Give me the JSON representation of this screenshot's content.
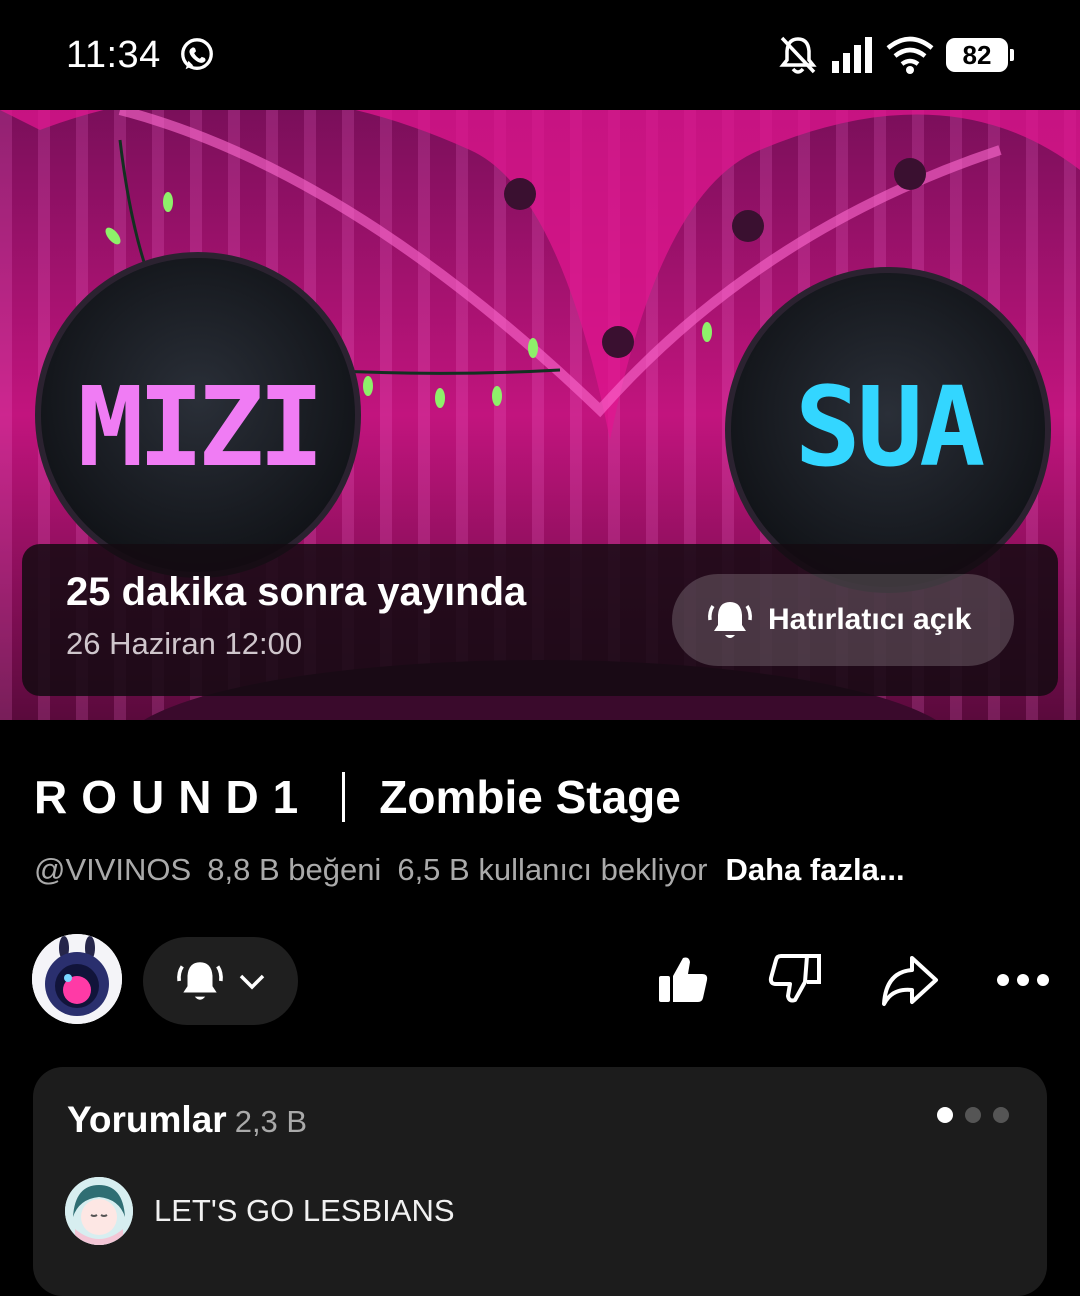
{
  "status_bar": {
    "time": "11:34",
    "battery": "82",
    "icons": [
      "whatsapp-icon",
      "bell-muted-icon",
      "signal-icon",
      "wifi-icon",
      "battery-icon"
    ]
  },
  "video": {
    "left_sign": "MIZI",
    "right_sign": "SUA",
    "live_title": "25 dakika sonra yayında",
    "live_date": "26 Haziran 12:00",
    "reminder_label": "Hatırlatıcı açık"
  },
  "title": {
    "part_a": "ROUND1",
    "part_b": "Zombie Stage"
  },
  "meta": {
    "channel": "@VIVINOS",
    "likes": "8,8 B beğeni",
    "waiting": "6,5 B kullanıcı bekliyor",
    "more": "Daha fazla..."
  },
  "actions": [
    "bell-icon",
    "chevron-down-icon",
    "like-icon",
    "dislike-icon",
    "share-icon",
    "more-icon"
  ],
  "comments": {
    "title": "Yorumlar",
    "count": "2,3 B",
    "first_comment": "LET'S GO LESBIANS",
    "page_dots_active": 0,
    "page_dots_total": 3
  },
  "colors": {
    "accent_pink": "#e8108f",
    "sign_cyan": "#33d6ff",
    "sign_pink": "#f07cf4",
    "card_bg": "#1c1c1c"
  }
}
